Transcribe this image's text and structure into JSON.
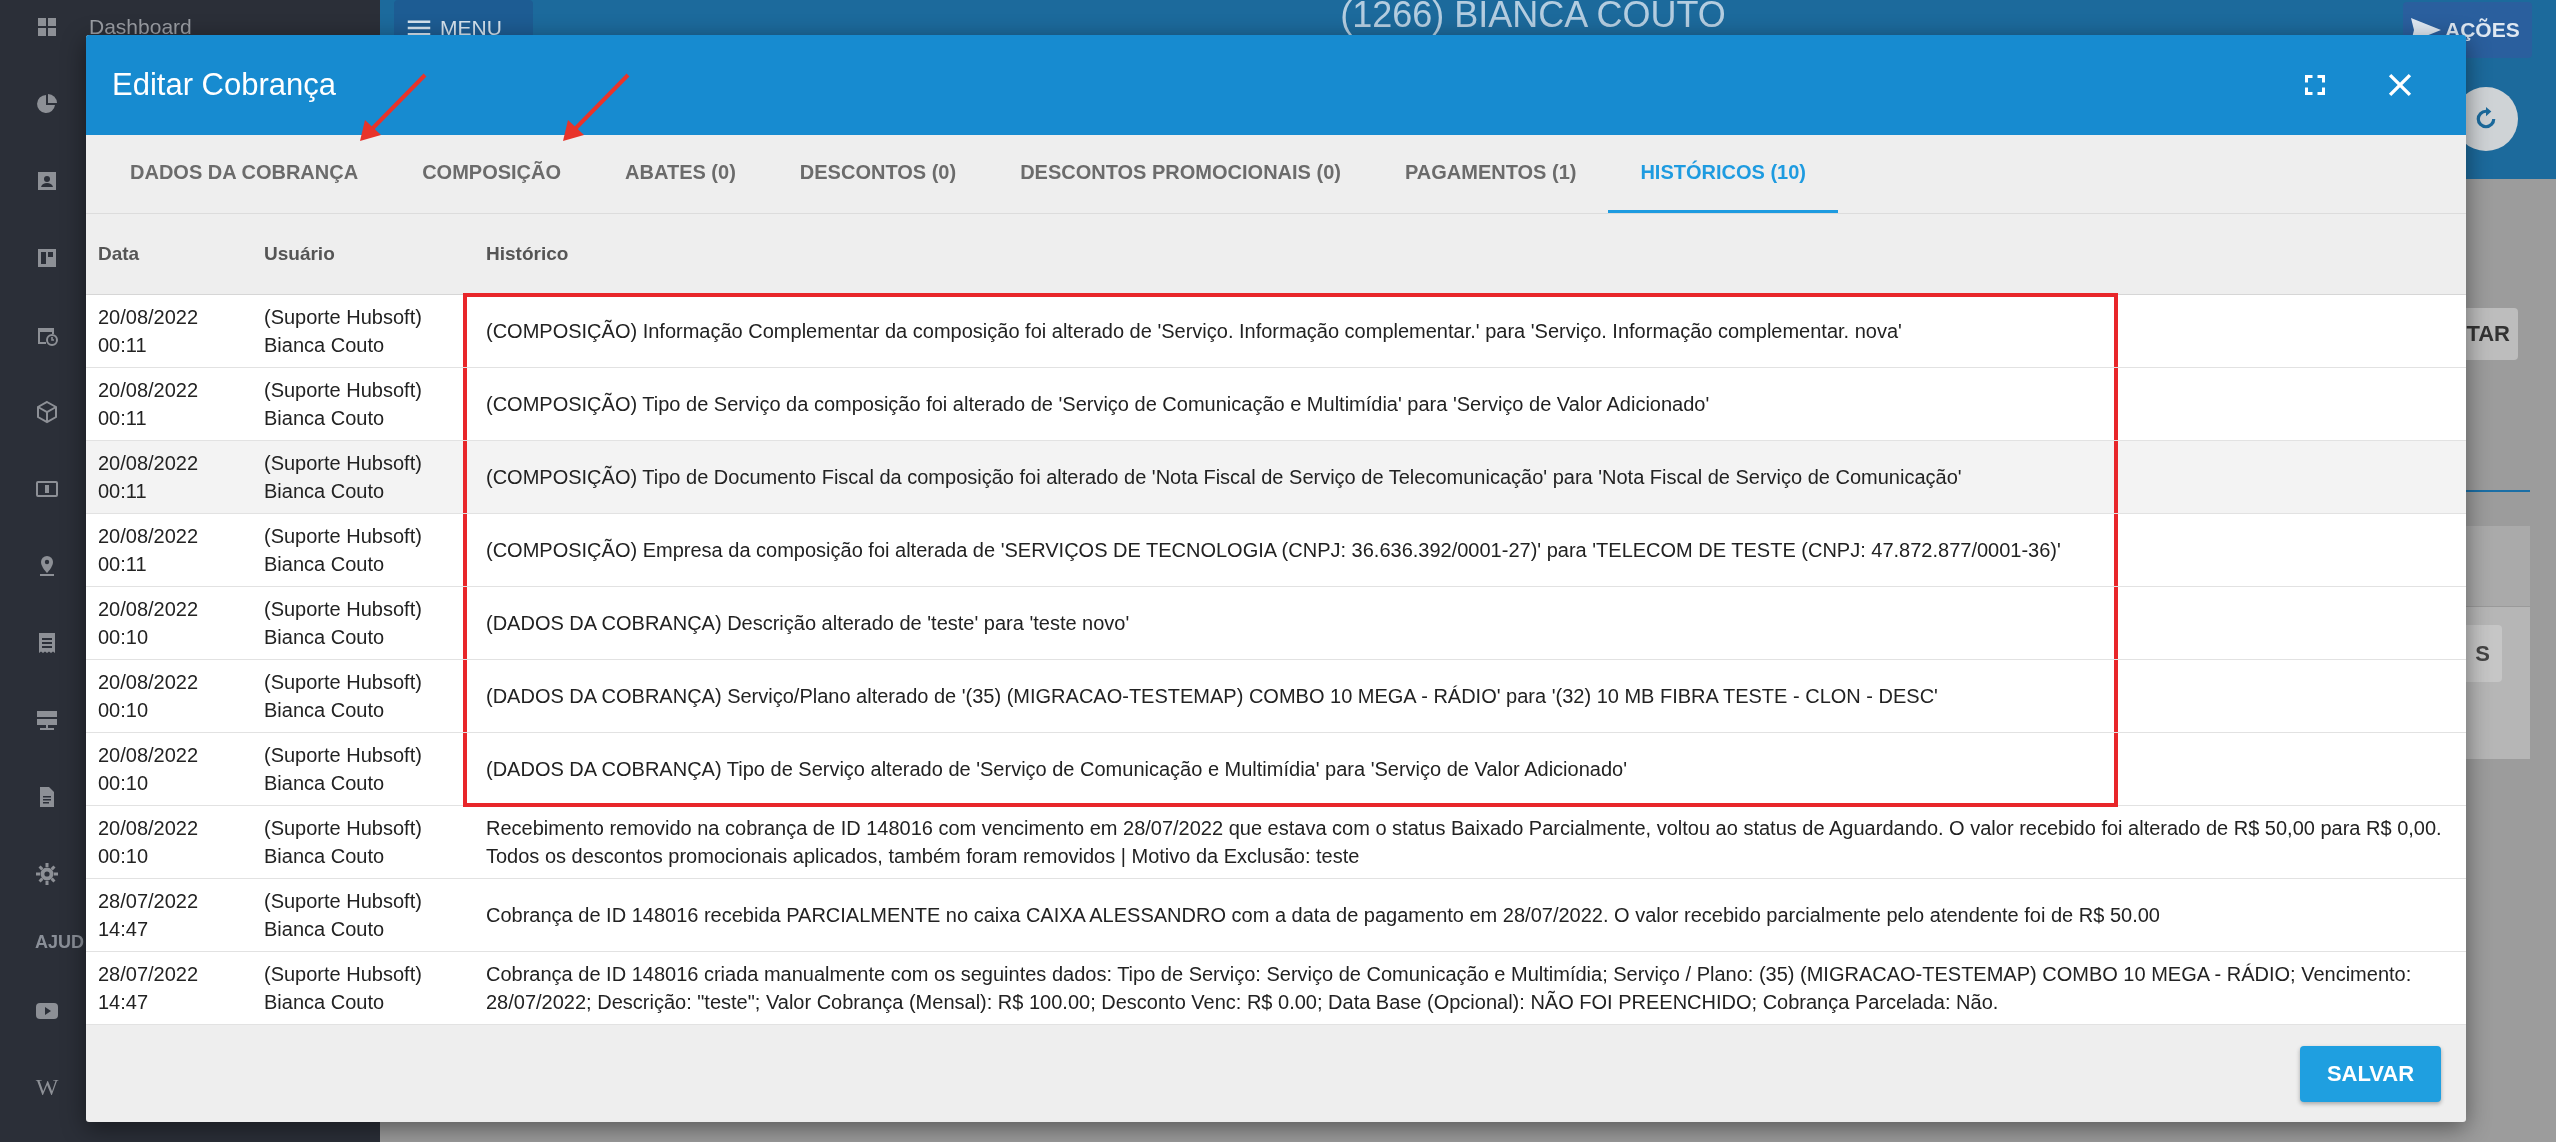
{
  "app": {
    "menu_button": "MENU",
    "title": "(1266) BIANCA COUTO",
    "actions_button": "AÇÕES",
    "side_buttons": [
      "TAR",
      "S"
    ]
  },
  "sidebar": {
    "first_label": "Dashboard",
    "section_label": "AJUD",
    "wiki_glyph": "W"
  },
  "dialog": {
    "title": "Editar Cobrança",
    "tabs": [
      {
        "label": "DADOS DA COBRANÇA",
        "selected": false,
        "annotated": true
      },
      {
        "label": "COMPOSIÇÃO",
        "selected": false,
        "annotated": true
      },
      {
        "label": "ABATES (0)",
        "selected": false,
        "annotated": false
      },
      {
        "label": "DESCONTOS (0)",
        "selected": false,
        "annotated": false
      },
      {
        "label": "DESCONTOS PROMOCIONAIS (0)",
        "selected": false,
        "annotated": false
      },
      {
        "label": "PAGAMENTOS (1)",
        "selected": false,
        "annotated": false
      },
      {
        "label": "HISTÓRICOS (10)",
        "selected": true,
        "annotated": false
      }
    ],
    "table": {
      "columns": [
        "Data",
        "Usuário",
        "Histórico"
      ],
      "rows": [
        {
          "date": "20/08/2022",
          "time": "00:11",
          "user": "(Suporte Hubsoft) Bianca Couto",
          "text": "(COMPOSIÇÃO) Informação Complementar da composição foi alterado de 'Serviço. Informação complementar.' para 'Serviço. Informação complementar. nova'",
          "highlighted": true,
          "hovered": false
        },
        {
          "date": "20/08/2022",
          "time": "00:11",
          "user": "(Suporte Hubsoft) Bianca Couto",
          "text": "(COMPOSIÇÃO) Tipo de Serviço da composição foi alterado de 'Serviço de Comunicação e Multimídia' para 'Serviço de Valor Adicionado'",
          "highlighted": true,
          "hovered": false
        },
        {
          "date": "20/08/2022",
          "time": "00:11",
          "user": "(Suporte Hubsoft) Bianca Couto",
          "text": "(COMPOSIÇÃO) Tipo de Documento Fiscal da composição foi alterado de 'Nota Fiscal de Serviço de Telecomunicação' para 'Nota Fiscal de Serviço de Comunicação'",
          "highlighted": true,
          "hovered": true
        },
        {
          "date": "20/08/2022",
          "time": "00:11",
          "user": "(Suporte Hubsoft) Bianca Couto",
          "text": "(COMPOSIÇÃO) Empresa da composição foi alterada de 'SERVIÇOS DE TECNOLOGIA (CNPJ: 36.636.392/0001-27)' para 'TELECOM DE TESTE (CNPJ: 47.872.877/0001-36)'",
          "highlighted": true,
          "hovered": false
        },
        {
          "date": "20/08/2022",
          "time": "00:10",
          "user": "(Suporte Hubsoft) Bianca Couto",
          "text": "(DADOS DA COBRANÇA) Descrição alterado de 'teste' para 'teste novo'",
          "highlighted": true,
          "hovered": false
        },
        {
          "date": "20/08/2022",
          "time": "00:10",
          "user": "(Suporte Hubsoft) Bianca Couto",
          "text": "(DADOS DA COBRANÇA) Serviço/Plano alterado de '(35) (MIGRACAO-TESTEMAP) COMBO 10 MEGA - RÁDIO' para '(32) 10 MB FIBRA TESTE - CLON - DESC'",
          "highlighted": true,
          "hovered": false
        },
        {
          "date": "20/08/2022",
          "time": "00:10",
          "user": "(Suporte Hubsoft) Bianca Couto",
          "text": "(DADOS DA COBRANÇA) Tipo de Serviço alterado de 'Serviço de Comunicação e Multimídia' para 'Serviço de Valor Adicionado'",
          "highlighted": true,
          "hovered": false
        },
        {
          "date": "20/08/2022",
          "time": "00:10",
          "user": "(Suporte Hubsoft) Bianca Couto",
          "text": "Recebimento removido na cobrança de ID 148016 com vencimento em 28/07/2022 que estava com o status Baixado Parcialmente, voltou ao status de Aguardando. O valor recebido foi alterado de R$ 50,00 para R$ 0,00. Todos os descontos promocionais aplicados, também foram removidos | Motivo da Exclusão: teste",
          "highlighted": false,
          "hovered": false
        },
        {
          "date": "28/07/2022",
          "time": "14:47",
          "user": "(Suporte Hubsoft) Bianca Couto",
          "text": "Cobrança de ID 148016 recebida PARCIALMENTE no caixa CAIXA ALESSANDRO com a data de pagamento em 28/07/2022. O valor recebido parcialmente pelo atendente foi de R$ 50.00",
          "highlighted": false,
          "hovered": false
        },
        {
          "date": "28/07/2022",
          "time": "14:47",
          "user": "(Suporte Hubsoft) Bianca Couto",
          "text": "Cobrança de ID 148016 criada manualmente com os seguintes dados: Tipo de Serviço: Serviço de Comunicação e Multimídia; Serviço / Plano: (35) (MIGRACAO-TESTEMAP) COMBO 10 MEGA - RÁDIO; Vencimento: 28/07/2022; Descrição: \"teste\"; Valor Cobrança (Mensal): R$ 100.00; Desconto Venc: R$ 0.00; Data Base (Opcional): NÃO FOI PREENCHIDO; Cobrança Parcelada: Não.",
          "highlighted": false,
          "hovered": false
        }
      ]
    },
    "save_button": "SALVAR"
  }
}
